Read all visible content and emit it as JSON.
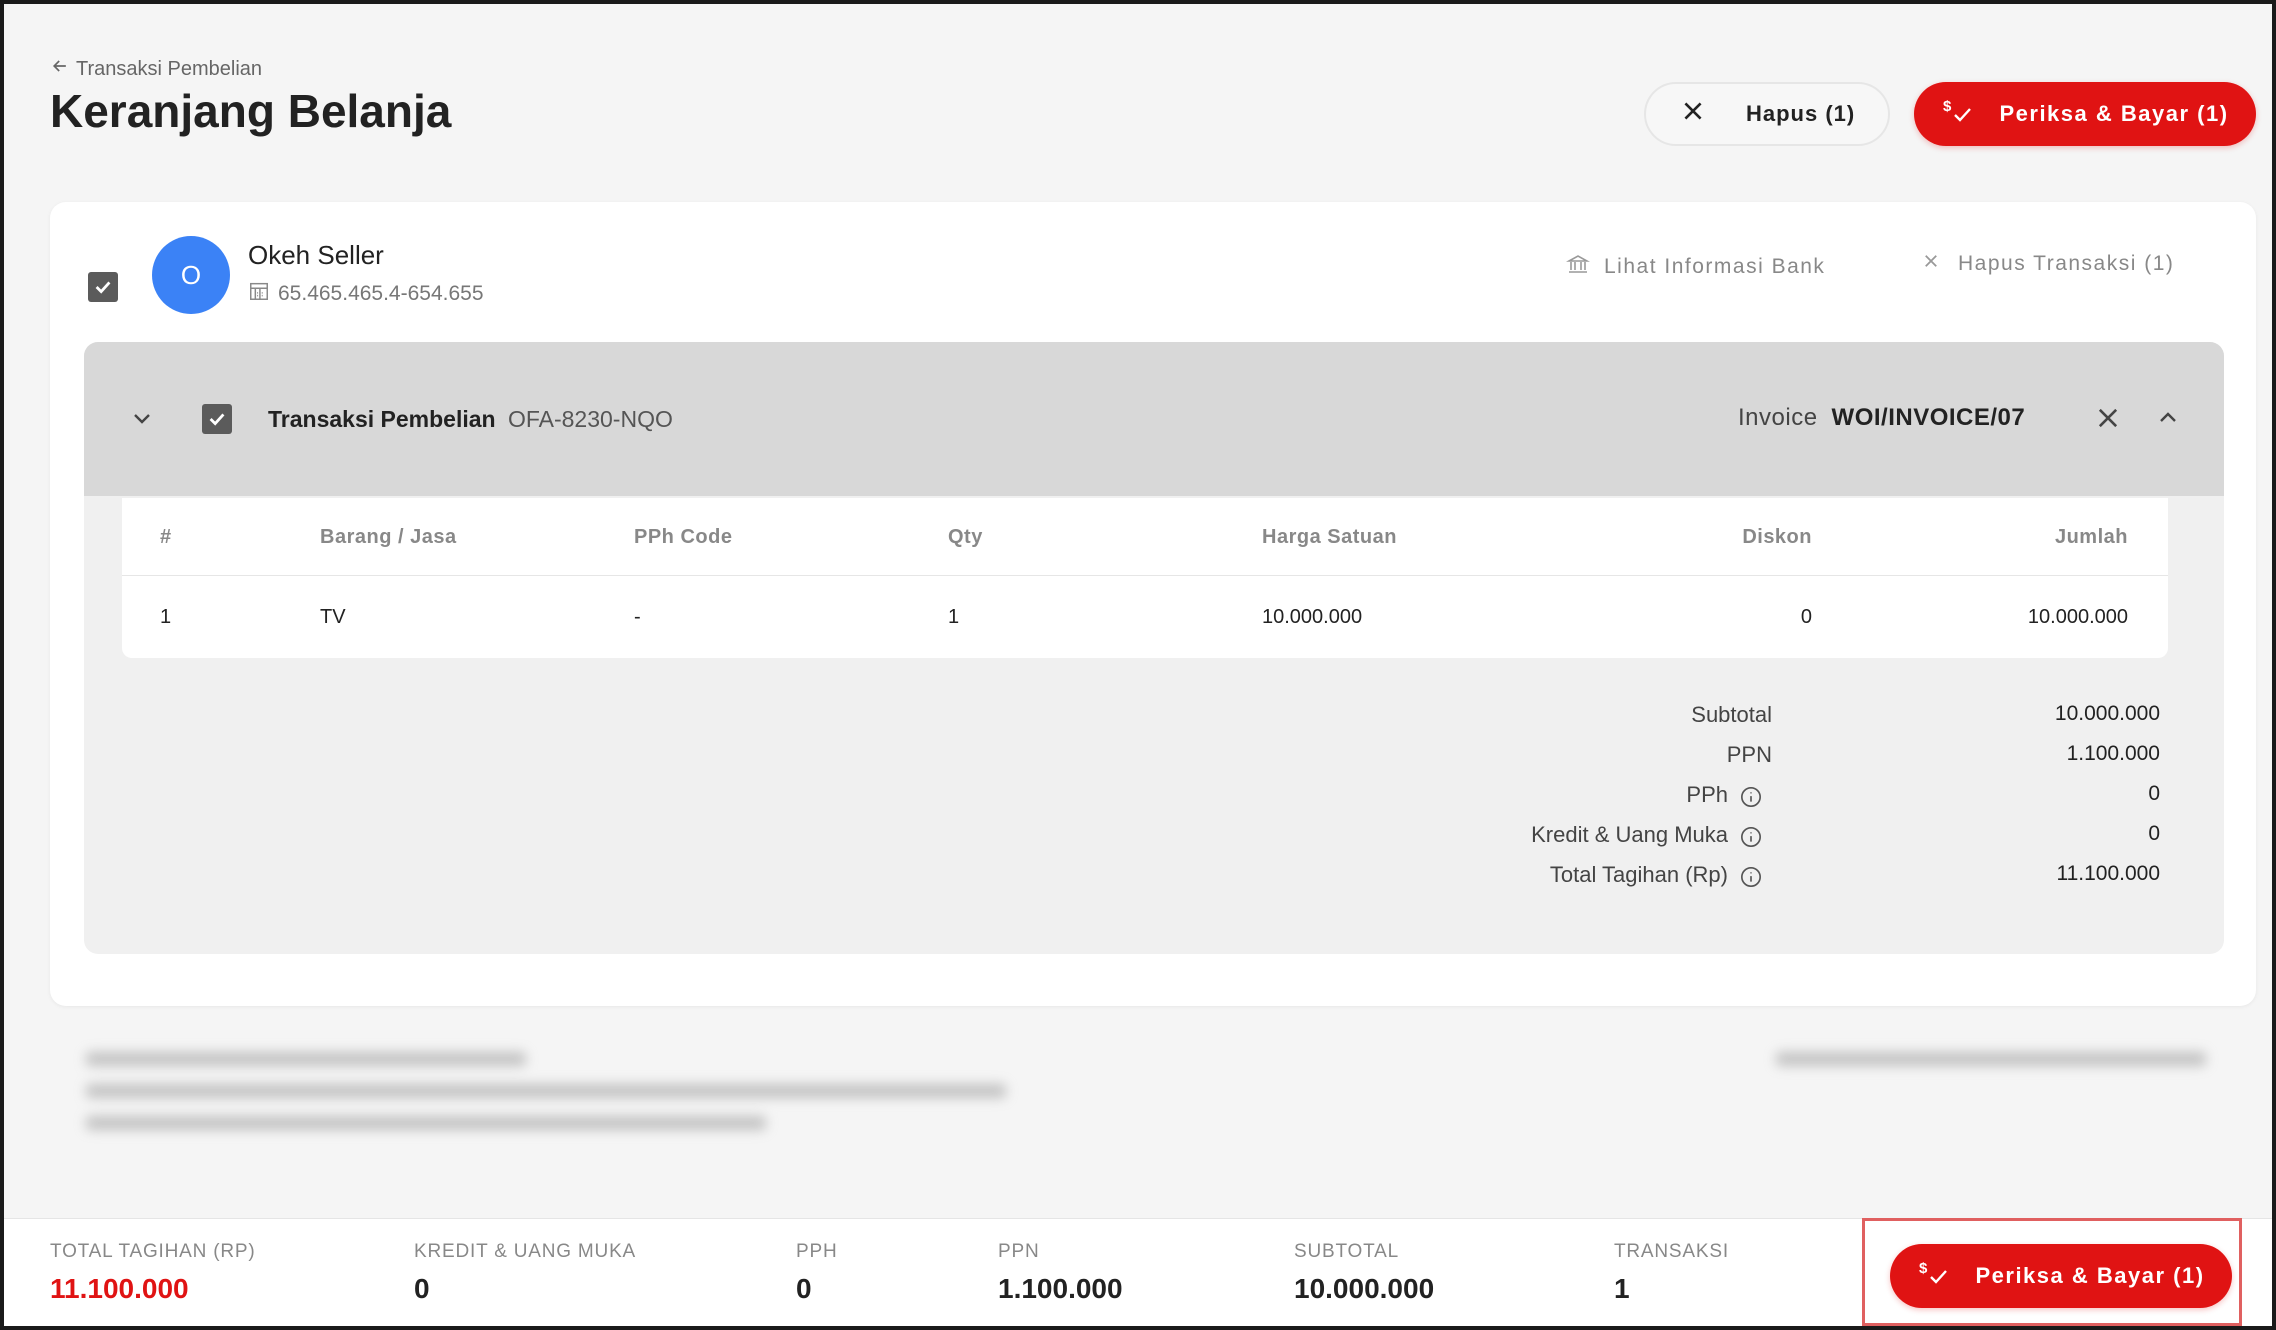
{
  "header": {
    "breadcrumb": "Transaksi Pembelian",
    "title": "Keranjang Belanja",
    "hapus_label": "Hapus (1)",
    "bayar_label": "Periksa & Bayar (1)"
  },
  "seller": {
    "avatar_letter": "O",
    "name": "Okeh Seller",
    "npwp": "65.465.465.4-654.655",
    "bank_link": "Lihat Informasi Bank",
    "hapus_transaksi": "Hapus Transaksi (1)"
  },
  "transaction": {
    "label": "Transaksi Pembelian",
    "code": "OFA-8230-NQO",
    "invoice_label": "Invoice",
    "invoice_number": "WOI/INVOICE/07",
    "columns": [
      "#",
      "Barang / Jasa",
      "PPh Code",
      "Qty",
      "Harga Satuan",
      "Diskon",
      "Jumlah"
    ],
    "rows": [
      {
        "no": "1",
        "item": "TV",
        "pph": "-",
        "qty": "1",
        "harga": "10.000.000",
        "diskon": "0",
        "jumlah": "10.000.000"
      }
    ],
    "totals": {
      "subtotal_label": "Subtotal",
      "subtotal": "10.000.000",
      "ppn_label": "PPN",
      "ppn": "1.100.000",
      "pph_label": "PPh",
      "pph": "0",
      "kredit_label": "Kredit & Uang Muka",
      "kredit": "0",
      "total_label": "Total Tagihan (Rp)",
      "total": "11.100.000"
    }
  },
  "footer": {
    "total_label": "TOTAL TAGIHAN (RP)",
    "total": "11.100.000",
    "kredit_label": "KREDIT & UANG MUKA",
    "kredit": "0",
    "pph_label": "PPH",
    "pph": "0",
    "ppn_label": "PPN",
    "ppn": "1.100.000",
    "subtotal_label": "SUBTOTAL",
    "subtotal": "10.000.000",
    "transaksi_label": "TRANSAKSI",
    "transaksi": "1",
    "bayar_label": "Periksa & Bayar (1)"
  },
  "colors": {
    "primary": "#e01313",
    "avatar": "#3b82f6"
  },
  "icons": [
    "arrow-left-icon",
    "close-icon",
    "payment-check-icon",
    "checkbox-icon",
    "npwp-building-icon",
    "bank-icon",
    "chevron-down-icon",
    "chevron-up-icon",
    "info-icon"
  ]
}
